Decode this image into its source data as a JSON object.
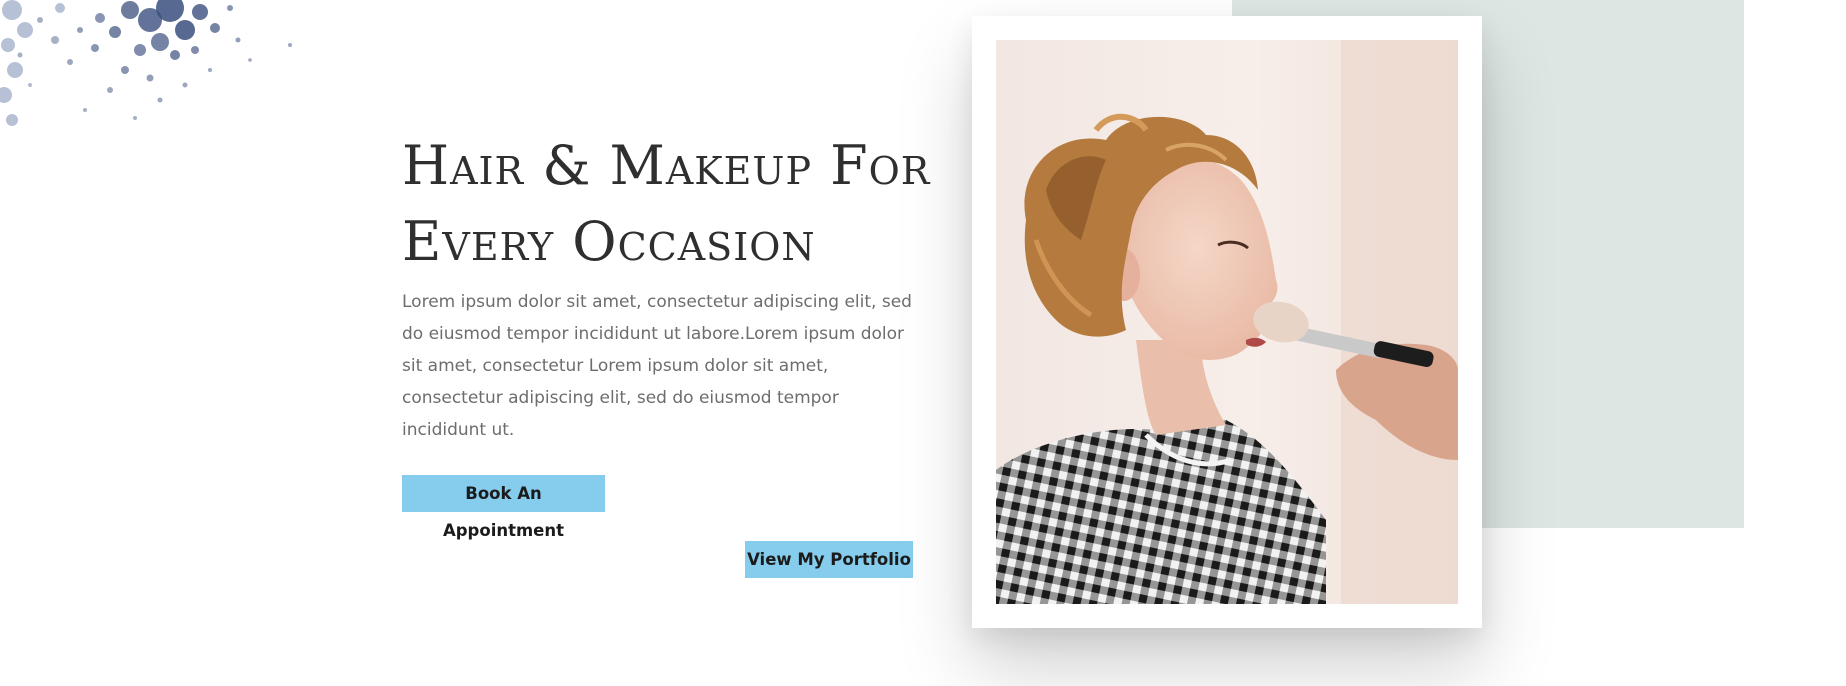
{
  "hero": {
    "headline": "Hair & Makeup For Every Occasion",
    "body": "Lorem ipsum dolor sit amet, consectetur adipiscing elit, sed do eiusmod tempor incididunt ut labore.Lorem ipsum dolor sit amet, consectetur Lorem ipsum dolor sit amet, consectetur adipiscing elit, sed do eiusmod tempor incididunt ut.",
    "primary_button_label": "Book An Appointment",
    "secondary_button_label": "View My Portfolio"
  },
  "colors": {
    "button": "#86ccec",
    "mint_panel": "#dde6e3",
    "headline": "#2f2f2f",
    "body_text": "#6d6d6d",
    "powder": "#3b4f7e"
  },
  "images": {
    "portrait": "woman-receiving-makeup-brush-photo",
    "decoration": "eyeshadow-powder-icon"
  }
}
